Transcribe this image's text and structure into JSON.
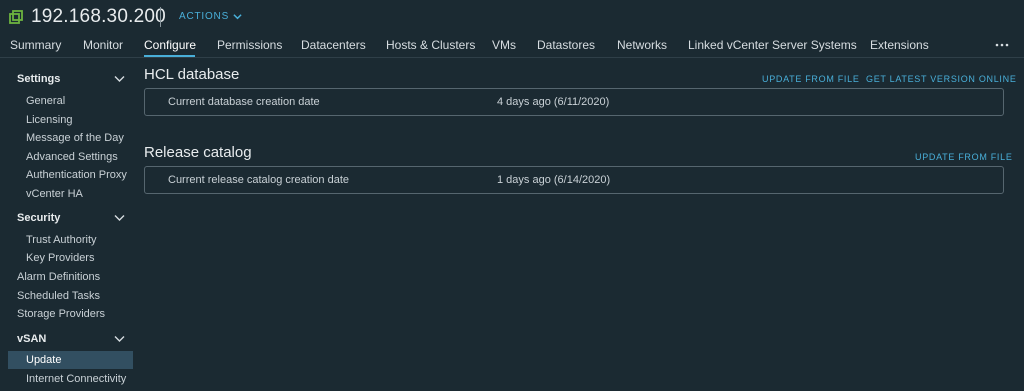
{
  "header": {
    "title": "192.168.30.200",
    "actions_label": "ACTIONS"
  },
  "tabs": [
    {
      "label": "Summary"
    },
    {
      "label": "Monitor"
    },
    {
      "label": "Configure"
    },
    {
      "label": "Permissions"
    },
    {
      "label": "Datacenters"
    },
    {
      "label": "Hosts & Clusters"
    },
    {
      "label": "VMs"
    },
    {
      "label": "Datastores"
    },
    {
      "label": "Networks"
    },
    {
      "label": "Linked vCenter Server Systems"
    },
    {
      "label": "Extensions"
    }
  ],
  "active_tab": "Configure",
  "sidebar": {
    "settings": {
      "label": "Settings",
      "items": [
        "General",
        "Licensing",
        "Message of the Day",
        "Advanced Settings",
        "Authentication Proxy",
        "vCenter HA"
      ]
    },
    "security": {
      "label": "Security",
      "items": [
        "Trust Authority",
        "Key Providers"
      ]
    },
    "top_items": [
      "Alarm Definitions",
      "Scheduled Tasks",
      "Storage Providers"
    ],
    "vsan": {
      "label": "vSAN",
      "items": [
        "Update",
        "Internet Connectivity"
      ]
    },
    "selected": "Update"
  },
  "main": {
    "hcl": {
      "title": "HCL database",
      "update_link": "UPDATE FROM FILE",
      "latest_link": "GET LATEST VERSION ONLINE",
      "label": "Current database creation date",
      "value": "4 days ago (6/11/2020)"
    },
    "release": {
      "title": "Release catalog",
      "update_link": "UPDATE FROM FILE",
      "label": "Current release catalog creation date",
      "value": "1 days ago (6/14/2020)"
    }
  },
  "colors": {
    "background": "#1b2a32",
    "accent": "#49afd9",
    "selected_bg": "#324f61",
    "host_icon": "#6db33f"
  },
  "icons": [
    "host-icon",
    "chevron-down-icon",
    "more-horizontal-icon"
  ]
}
